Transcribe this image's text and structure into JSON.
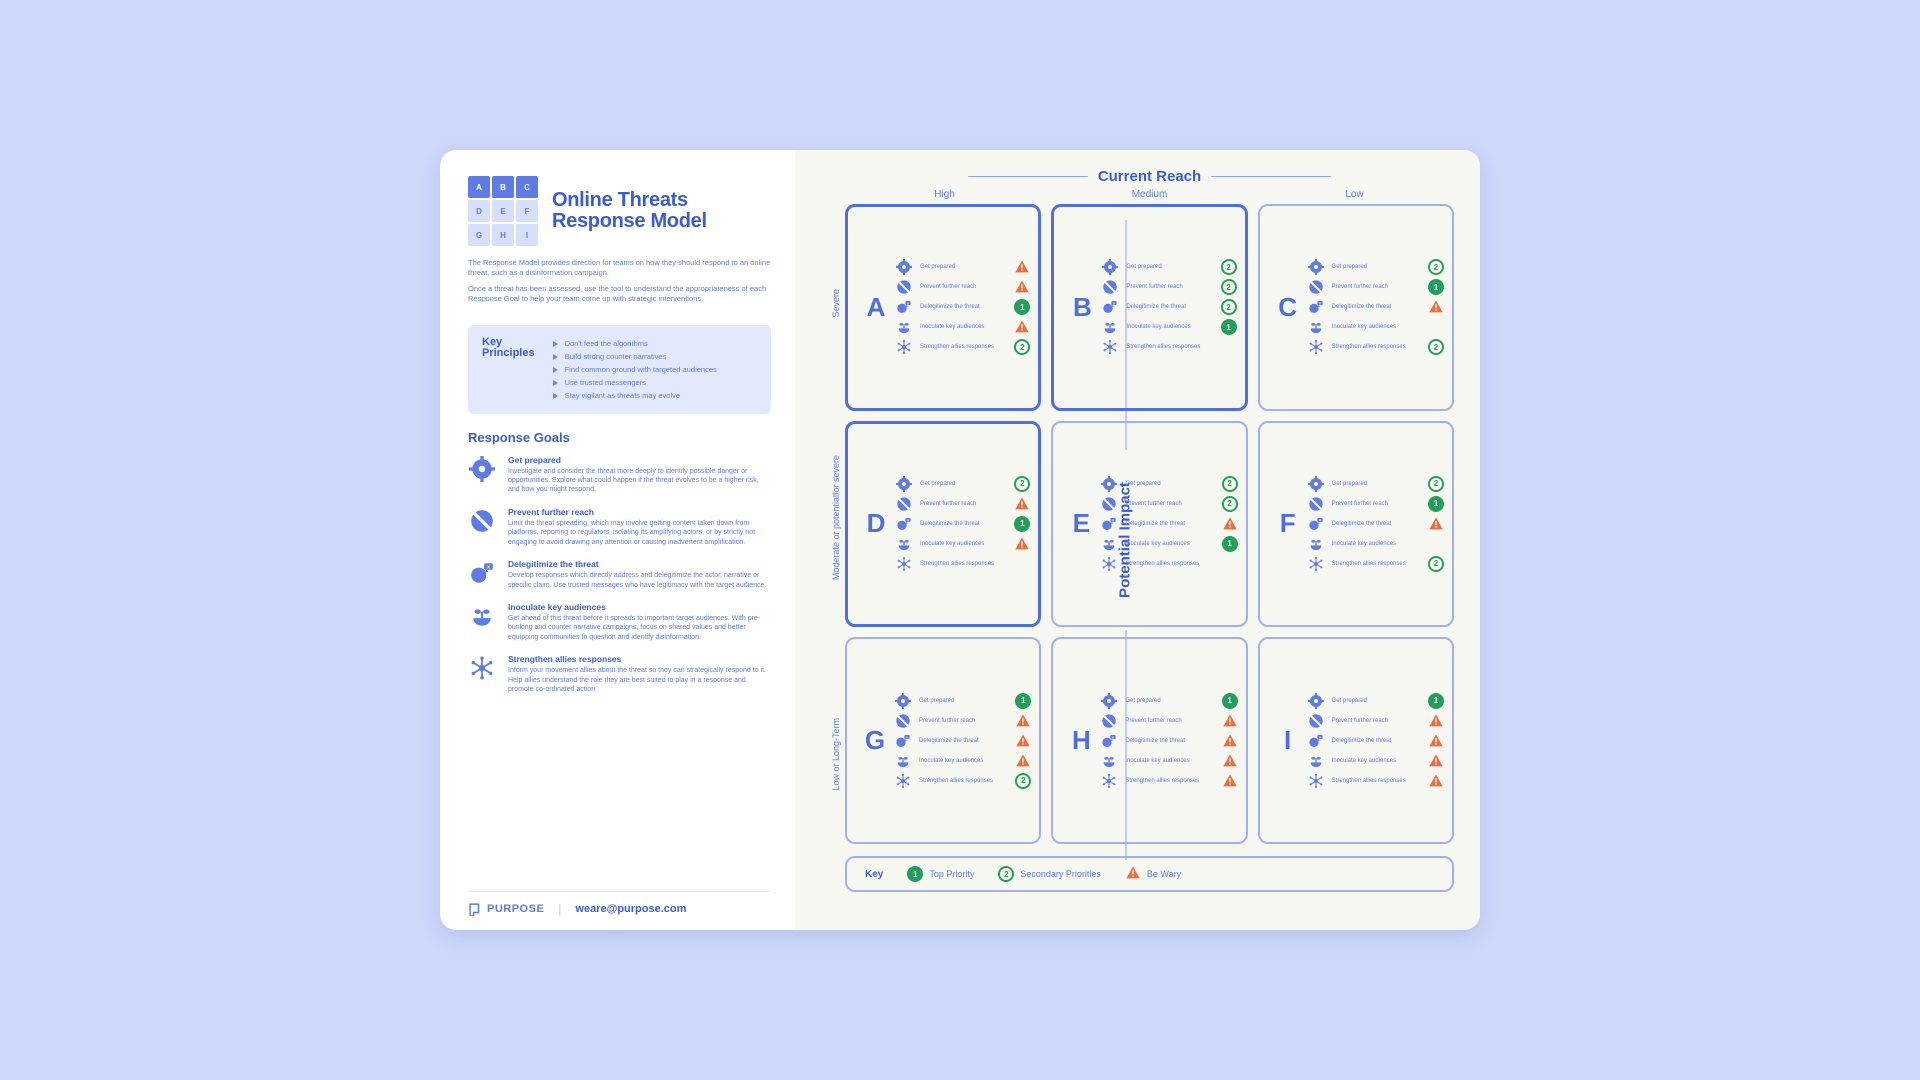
{
  "title_line1": "Online Threats",
  "title_line2": "Response Model",
  "mini_grid": [
    "A",
    "B",
    "C",
    "D",
    "E",
    "F",
    "G",
    "H",
    "I"
  ],
  "mini_grid_lit": [
    0,
    1,
    2
  ],
  "intro": [
    "The Response Model provides direction for teams on how they should respond to an online threat, such as a disinformation campaign.",
    "Once a threat has been assessed, use the tool to understand the appropriateness of each Response Goal to help your team come up with strategic interventions."
  ],
  "key_principles_heading": "Key\nPrinciples",
  "key_principles": [
    "Don't feed the algorithms",
    "Build strong counter narratives",
    "Find common ground with targeted audiences",
    "Use trusted messengers",
    "Stay vigilant as threats may evolve"
  ],
  "response_goals_heading": "Response Goals",
  "goals": [
    {
      "icon": "gear",
      "title": "Get prepared",
      "body": "Investigate and consider the threat more deeply to identify possible danger or opportunities. Explore what could happen if the threat evolves to be a higher risk, and how you might respond."
    },
    {
      "icon": "block",
      "title": "Prevent further reach",
      "body": "Limit the threat spreading, which may involve getting content taken down from platforms, reporting to regulators, isolating its amplifying actors, or by strictly not engaging to avoid drawing any attention or causing inadvertent amplification."
    },
    {
      "icon": "speak",
      "title": "Delegitimize the threat",
      "body": "Develop responses which directly address and delegitimize the actor, narrative or specific claim. Use trusted messages who have legitimacy with the target audience."
    },
    {
      "icon": "plant",
      "title": "Inoculate key audiences",
      "body": "Get ahead of this threat before it spreads to important target audiences. With pre-bunking and counter narrative campaigns, focus on shared values and better equipping communities to question and identify disinformation."
    },
    {
      "icon": "network",
      "title": "Strengthen allies responses",
      "body": "Inform your movement allies about the threat so they can strategically respond to it. Help allies understand the role they are best suited to play in a response and promote co-ordinated action."
    }
  ],
  "footer": {
    "brand": "PURPOSE",
    "email": "weare@purpose.com"
  },
  "axis_x": "Current Reach",
  "axis_y": "Potential Impact",
  "col_heads": [
    "High",
    "Medium",
    "Low"
  ],
  "row_heads": [
    "Severe",
    "Moderate or potentialfor severe",
    "Low or Long-Term"
  ],
  "goal_short_labels": [
    "Get prepared",
    "Prevent further reach",
    "Delegitimize the threat",
    "Inoculate key audiences",
    "Strengthen allies responses"
  ],
  "cells": [
    {
      "letter": "A",
      "strong": true,
      "marks": [
        "warn",
        "warn",
        "1",
        "warn",
        "2"
      ]
    },
    {
      "letter": "B",
      "strong": true,
      "marks": [
        "2",
        "2",
        "2",
        "1",
        "none"
      ]
    },
    {
      "letter": "C",
      "strong": false,
      "marks": [
        "2",
        "1",
        "warn",
        "none",
        "2"
      ]
    },
    {
      "letter": "D",
      "strong": true,
      "marks": [
        "2",
        "warn",
        "1",
        "warn",
        "none"
      ]
    },
    {
      "letter": "E",
      "strong": false,
      "marks": [
        "2",
        "2",
        "warn",
        "1",
        "none"
      ]
    },
    {
      "letter": "F",
      "strong": false,
      "marks": [
        "2",
        "1",
        "warn",
        "none",
        "2"
      ]
    },
    {
      "letter": "G",
      "strong": false,
      "marks": [
        "1",
        "warn",
        "warn",
        "warn",
        "2"
      ]
    },
    {
      "letter": "H",
      "strong": false,
      "marks": [
        "1",
        "warn",
        "warn",
        "warn",
        "warn"
      ]
    },
    {
      "letter": "I",
      "strong": false,
      "marks": [
        "1",
        "warn",
        "warn",
        "warn",
        "warn"
      ]
    }
  ],
  "key_label": "Key",
  "key_items": [
    {
      "mark": "1",
      "label": "Top Priority"
    },
    {
      "mark": "2",
      "label": "Secondary Priorities"
    },
    {
      "mark": "warn",
      "label": "Be Wary"
    }
  ]
}
